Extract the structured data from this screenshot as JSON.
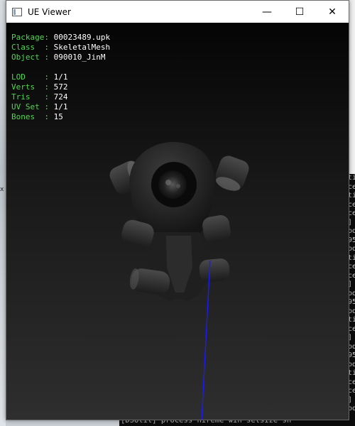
{
  "window": {
    "title": "UE Viewer",
    "controls": {
      "minimize": "—",
      "maximize": "☐",
      "close": "✕"
    }
  },
  "info_group1": [
    {
      "label": "Package: ",
      "value": "00023489.upk"
    },
    {
      "label": "Class  : ",
      "value": "SkeletalMesh"
    },
    {
      "label": "Object : ",
      "value": "090010_JinM"
    }
  ],
  "info_group2": [
    {
      "label": "LOD    : ",
      "value": "1/1"
    },
    {
      "label": "Verts  : ",
      "value": "572"
    },
    {
      "label": "Tris   : ",
      "value": "724"
    },
    {
      "label": "UV Set : ",
      "value": "1/1"
    },
    {
      "label": "Bones  : ",
      "value": "15"
    }
  ],
  "console": {
    "right_column": [
      "ti",
      "ce",
      "ti",
      "ce",
      "ce",
      "]",
      "od",
      "95",
      "od",
      "ti",
      "ce",
      "ce",
      "]",
      "od",
      "95",
      "od",
      "ti",
      "ce",
      "]",
      "od",
      "95",
      "od",
      "ti",
      "ce",
      "ce",
      "]",
      "od",
      "95"
    ],
    "bottom_line": "[DSUtil] process  hireme win setsize  sh"
  },
  "left_edge_mark": "x",
  "colors": {
    "label": "#4fd94f",
    "value": "#ffffff",
    "axis": "#1a1aff"
  }
}
